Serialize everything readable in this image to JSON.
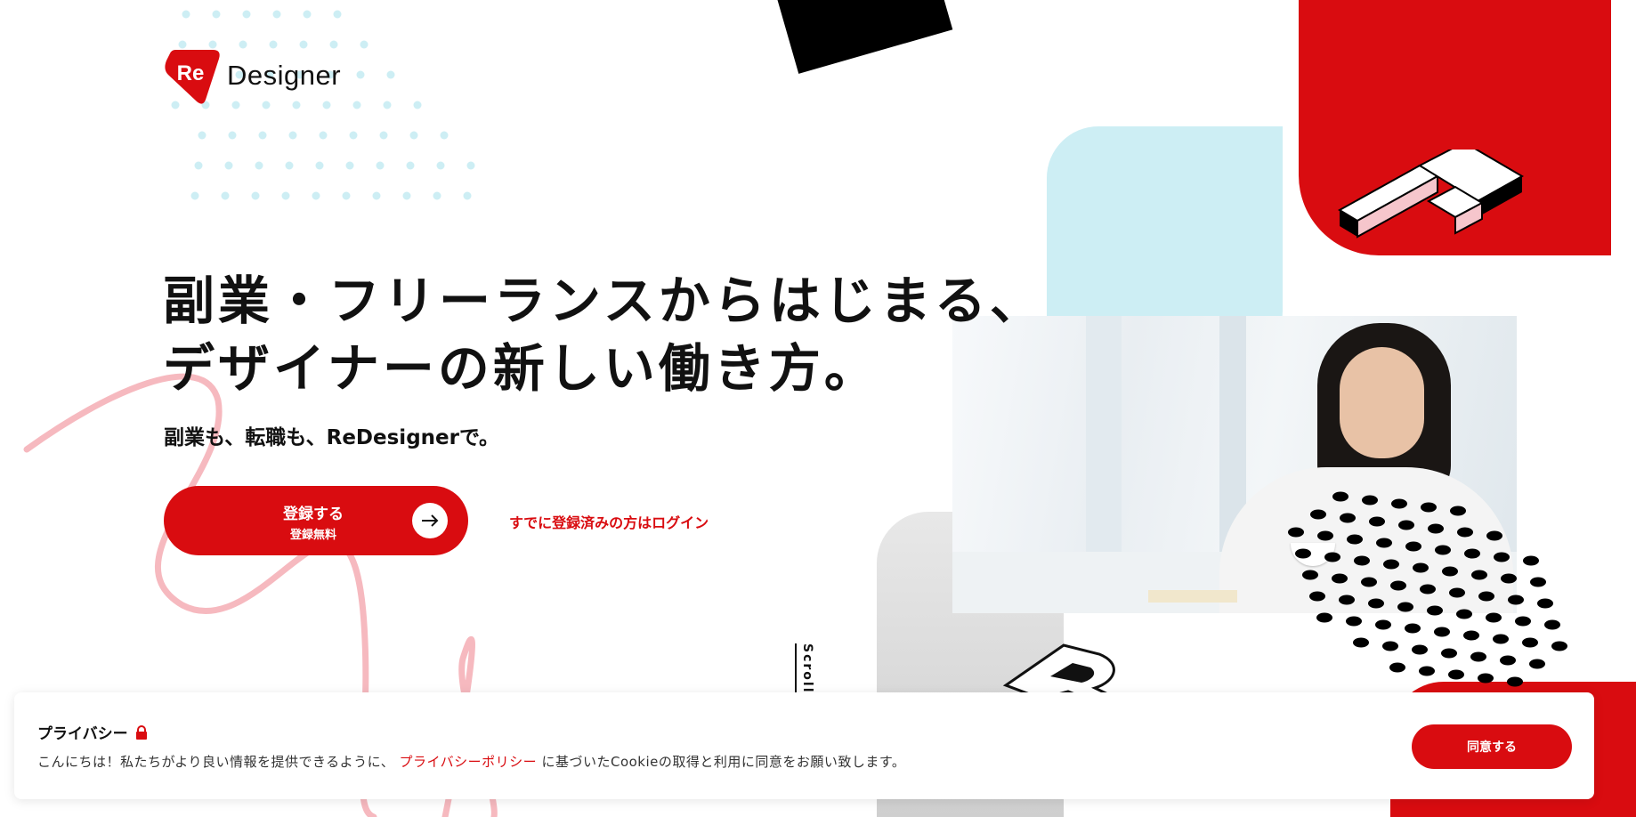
{
  "brand": {
    "logo_mark": "Re",
    "logo_text": "Designer",
    "red": "#d90c10",
    "light_blue": "#cdeef4",
    "pink": "#f6b9bf"
  },
  "hero": {
    "headline_line1": "副業・フリーランスからはじまる、",
    "headline_line2": "デザイナーの新しい働き方。",
    "subline": "副業も、転職も、ReDesignerで。",
    "cta_main": "登録する",
    "cta_sub": "登録無料",
    "login_link": "すでに登録済みの方はログイン"
  },
  "scroll_label": "Scroll d",
  "privacy": {
    "title": "プライバシー",
    "text_before": "こんにちは！私たちがより良い情報を提供できるように、",
    "policy_link": "プライバシーポリシー",
    "text_after": "に基づいたCookieの取得と利用に同意をお願い致します。",
    "agree_label": "同意する"
  },
  "icons": {
    "cta": "arrow-right-icon",
    "privacy": "lock-icon"
  }
}
